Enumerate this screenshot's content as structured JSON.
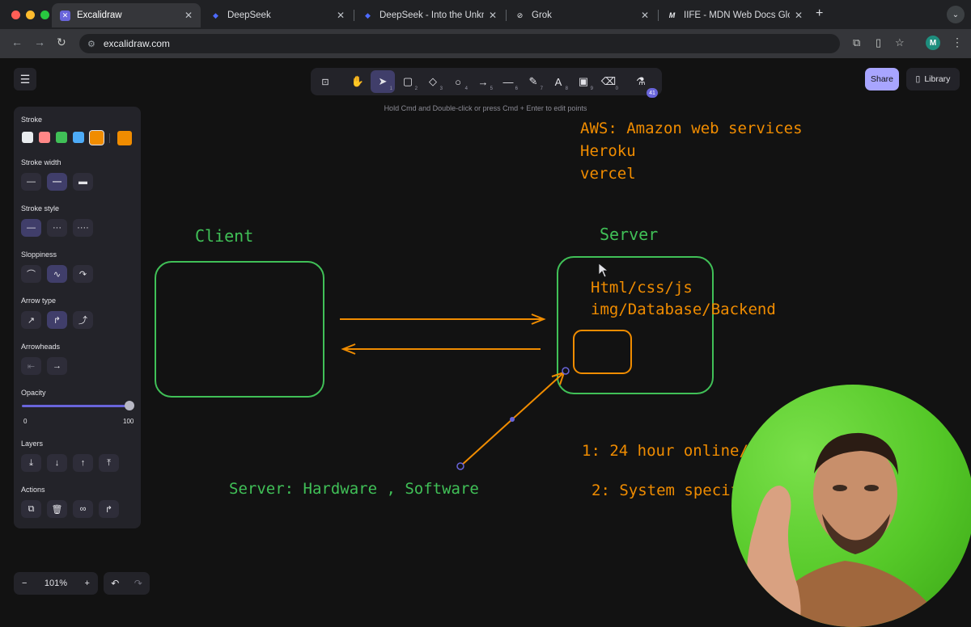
{
  "browser": {
    "tabs": [
      {
        "title": "Excalidraw",
        "active": true,
        "icon": "excalidraw-icon"
      },
      {
        "title": "DeepSeek",
        "active": false,
        "icon": "deepseek-icon"
      },
      {
        "title": "DeepSeek - Into the Unknown",
        "active": false,
        "icon": "deepseek-icon"
      },
      {
        "title": "Grok",
        "active": false,
        "icon": "grok-icon"
      },
      {
        "title": "IIFE - MDN Web Docs Glossa",
        "active": false,
        "icon": "mdn-icon"
      }
    ],
    "url": "excalidraw.com",
    "profile_initial": "M"
  },
  "excalidraw": {
    "hint": "Hold Cmd and Double-click or press Cmd + Enter to edit points",
    "share_label": "Share",
    "library_label": "Library",
    "tools": [
      {
        "name": "lock",
        "glyph": "🔓",
        "key": ""
      },
      {
        "name": "hand",
        "glyph": "✋",
        "key": ""
      },
      {
        "name": "selection",
        "glyph": "➤",
        "key": "1",
        "active": true
      },
      {
        "name": "rectangle",
        "glyph": "▢",
        "key": "2"
      },
      {
        "name": "diamond",
        "glyph": "◇",
        "key": "3"
      },
      {
        "name": "ellipse",
        "glyph": "○",
        "key": "4"
      },
      {
        "name": "arrow",
        "glyph": "→",
        "key": "5"
      },
      {
        "name": "line",
        "glyph": "—",
        "key": "6"
      },
      {
        "name": "draw",
        "glyph": "✎",
        "key": "7"
      },
      {
        "name": "text",
        "glyph": "A",
        "key": "8"
      },
      {
        "name": "image",
        "glyph": "▣",
        "key": "9"
      },
      {
        "name": "eraser",
        "glyph": "⌫",
        "key": "0"
      },
      {
        "name": "extra-tools",
        "glyph": "⚗",
        "key": "",
        "badge": "41"
      }
    ],
    "panel": {
      "stroke_label": "Stroke",
      "stroke_colors": [
        "#e9ecef",
        "#ff8787",
        "#40c057",
        "#4dabf7",
        "#f08c00"
      ],
      "current_stroke": "#f08c00",
      "stroke_width_label": "Stroke width",
      "stroke_style_label": "Stroke style",
      "sloppiness_label": "Sloppiness",
      "arrow_type_label": "Arrow type",
      "arrowheads_label": "Arrowheads",
      "opacity_label": "Opacity",
      "opacity_min": "0",
      "opacity_max": "100",
      "opacity_value": 100,
      "layers_label": "Layers",
      "actions_label": "Actions"
    },
    "zoom": "101%"
  },
  "drawing": {
    "client_label": "Client",
    "server_label": "Server",
    "server_items_1": "Html/css/js",
    "server_items_2": "img/Database/Backend",
    "hosting_1": "AWS: Amazon web services",
    "hosting_2": "Heroku",
    "hosting_3": "vercel",
    "server_def": "Server: Hardware , Software",
    "point_1": "1: 24 hour online/ c",
    "point_2": "2: System specif"
  },
  "colors": {
    "green": "#40c057",
    "orange": "#f08c00",
    "accent": "#6965db"
  }
}
